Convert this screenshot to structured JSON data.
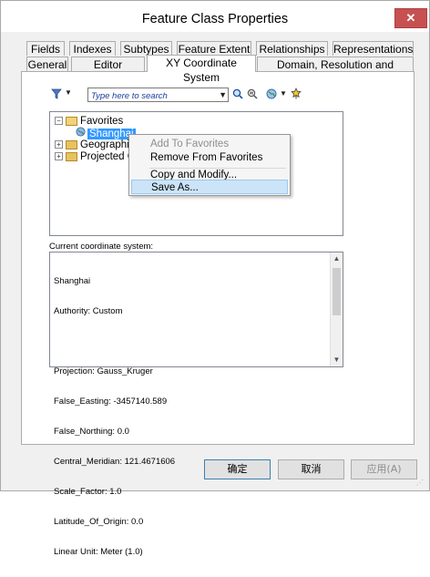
{
  "window": {
    "title": "Feature Class Properties",
    "close_label": "✕"
  },
  "tabs": {
    "row1": [
      "Fields",
      "Indexes",
      "Subtypes",
      "Feature Extent",
      "Relationships",
      "Representations"
    ],
    "row2": [
      "General",
      "Editor Tracking",
      "XY Coordinate System",
      "Domain, Resolution and Tolerance"
    ],
    "active": "XY Coordinate System"
  },
  "toolbar": {
    "filter_icon": "filter-icon",
    "search_placeholder": "Type here to search",
    "search_value": "",
    "icons": [
      "search-icon",
      "search-options-icon",
      "globe-icon",
      "dropdown-icon",
      "favorite-star-icon"
    ]
  },
  "tree": {
    "items": [
      {
        "label": "Favorites",
        "expander": "−",
        "icon": "open-folder-icon"
      },
      {
        "label": "Shanghai",
        "icon": "globe-icon",
        "selected": true
      },
      {
        "label": "Geographic",
        "expander": "+",
        "icon": "folder-icon"
      },
      {
        "label": "Projected C",
        "expander": "+",
        "icon": "folder-icon"
      }
    ]
  },
  "context_menu": {
    "items": [
      {
        "label": "Add To Favorites",
        "disabled": true
      },
      {
        "label": "Remove From Favorites"
      },
      {
        "label": "Copy and Modify..."
      },
      {
        "label": "Save As...",
        "highlight": true
      }
    ]
  },
  "coordinate_system": {
    "label": "Current coordinate system:",
    "lines": [
      "Shanghai",
      "Authority: Custom",
      "",
      "Projection: Gauss_Kruger",
      "False_Easting: -3457140.589",
      "False_Northing: 0.0",
      "Central_Meridian: 121.4671606",
      "Scale_Factor: 1.0",
      "Latitude_Of_Origin: 0.0",
      "Linear Unit: Meter (1.0)"
    ]
  },
  "buttons": {
    "ok": "确定",
    "cancel": "取消",
    "apply": "应用(A)"
  },
  "colors": {
    "selection": "#3399ff",
    "close": "#c75050",
    "menu_highlight": "#cce4f7"
  }
}
